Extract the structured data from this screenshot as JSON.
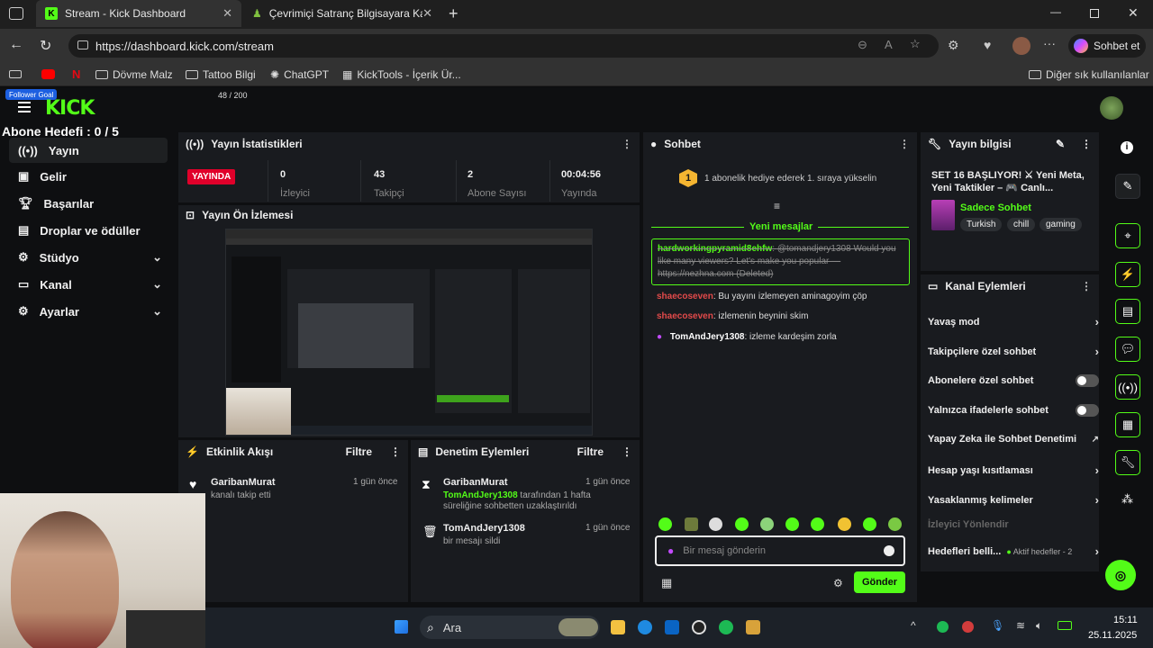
{
  "browser": {
    "tabs": [
      {
        "label": "Stream - Kick Dashboard",
        "active": true
      },
      {
        "label": "Çevrimiçi Satranç Bilgisayara Kar",
        "active": false
      }
    ],
    "url": "https://dashboard.kick.com/stream",
    "copilot_label": "Sohbet et",
    "bookmarks": [
      "Dövme Malz",
      "Tattoo Bilgi",
      "ChatGPT",
      "KickTools - İçerik Ür..."
    ],
    "other_bookmarks": "Diğer sık kullanılanlar"
  },
  "overlay": {
    "badge": "Follower Goal",
    "goal_count": "48 / 200",
    "sub_goal": "Abone Hedefi : 0 / 5"
  },
  "brand": {
    "logo": "KICK",
    "accent": "#53fc18"
  },
  "nav": [
    {
      "label": "Yayın",
      "icon": "broadcast-icon",
      "active": true
    },
    {
      "label": "Gelir",
      "icon": "revenue-icon"
    },
    {
      "label": "Başarılar",
      "icon": "trophy-icon"
    },
    {
      "label": "Droplar ve ödüller",
      "icon": "gift-icon"
    },
    {
      "label": "Stüdyo",
      "icon": "studio-icon",
      "expandable": true
    },
    {
      "label": "Kanal",
      "icon": "channel-icon",
      "expandable": true
    },
    {
      "label": "Ayarlar",
      "icon": "gear-icon",
      "expandable": true
    }
  ],
  "stats": {
    "title": "Yayın İstatistikleri",
    "live_badge": "YAYINDA",
    "items": [
      {
        "value": "0",
        "label": "İzleyici"
      },
      {
        "value": "43",
        "label": "Takipçi"
      },
      {
        "value": "2",
        "label": "Abone Sayısı"
      },
      {
        "value": "00:04:56",
        "label": "Yayında"
      }
    ]
  },
  "preview": {
    "title": "Yayın Ön İzlemesi"
  },
  "activity": {
    "title": "Etkinlik Akışı",
    "filter": "Filtre",
    "items": [
      {
        "user": "GaribanMurat",
        "text": "kanalı takip etti",
        "time": "1 gün önce"
      }
    ]
  },
  "moderation": {
    "title": "Denetim Eylemleri",
    "filter": "Filtre",
    "items": [
      {
        "user": "GaribanMurat",
        "time": "1 gün önce",
        "actor": "TomAndJery1308",
        "text": "tarafından 1 hafta süreliğine sohbetten uzaklaştırıldı"
      },
      {
        "user": "TomAndJery1308",
        "time": "1 gün önce",
        "actor": "",
        "text": "bir mesajı sildi"
      }
    ]
  },
  "chat": {
    "title": "Sohbet",
    "promo": "1 abonelik hediye ederek 1. sıraya yükselin",
    "new_messages": "Yeni mesajlar",
    "messages": [
      {
        "user": "hardworkingpyramid8ehfw",
        "text": "@tomandjery1308 Would you like many viewers? Let's make you popular — https://nezhna.com (Deleted)",
        "style": "deleted"
      },
      {
        "user": "shaecoseven",
        "text": "Bu yayını izlemeyen aminagoyim çöp",
        "style": "red"
      },
      {
        "user": "shaecoseven",
        "text": "izlemenin beynini skim",
        "style": "red"
      },
      {
        "user": "TomAndJery1308",
        "text": "izleme kardeşim zorla",
        "style": "owner"
      }
    ],
    "input_placeholder": "Bir mesaj gönderin",
    "send_label": "Gönder"
  },
  "stream_info": {
    "title": "Yayın bilgisi",
    "stream_title": "SET 16 BAŞLIYOR! ⚔ Yeni Meta, Yeni Taktikler – 🎮 Canlı...",
    "category": "Sadece Sohbet",
    "tags": [
      "Turkish",
      "chill",
      "gaming"
    ]
  },
  "channel_actions": {
    "title": "Kanal Eylemleri",
    "items": [
      {
        "label": "Yavaş mod",
        "control": "chevron"
      },
      {
        "label": "Takipçilere özel sohbet",
        "control": "chevron"
      },
      {
        "label": "Abonelere özel sohbet",
        "control": "toggle"
      },
      {
        "label": "Yalnızca ifadelerle sohbet",
        "control": "toggle"
      },
      {
        "label": "Yapay Zeka ile Sohbet Denetimi",
        "control": "external"
      },
      {
        "label": "Hesap yaşı kısıtlaması",
        "control": "chevron"
      },
      {
        "label": "Yasaklanmış kelimeler",
        "control": "chevron"
      },
      {
        "label": "İzleyici Yönlendir",
        "control": "disabled"
      },
      {
        "label": "Hedefleri belli...",
        "control": "chevron",
        "status": "Aktif hedefler - 2"
      }
    ]
  },
  "taskbar": {
    "search": "Ara",
    "time": "15:11",
    "date": "25.11.2025"
  }
}
